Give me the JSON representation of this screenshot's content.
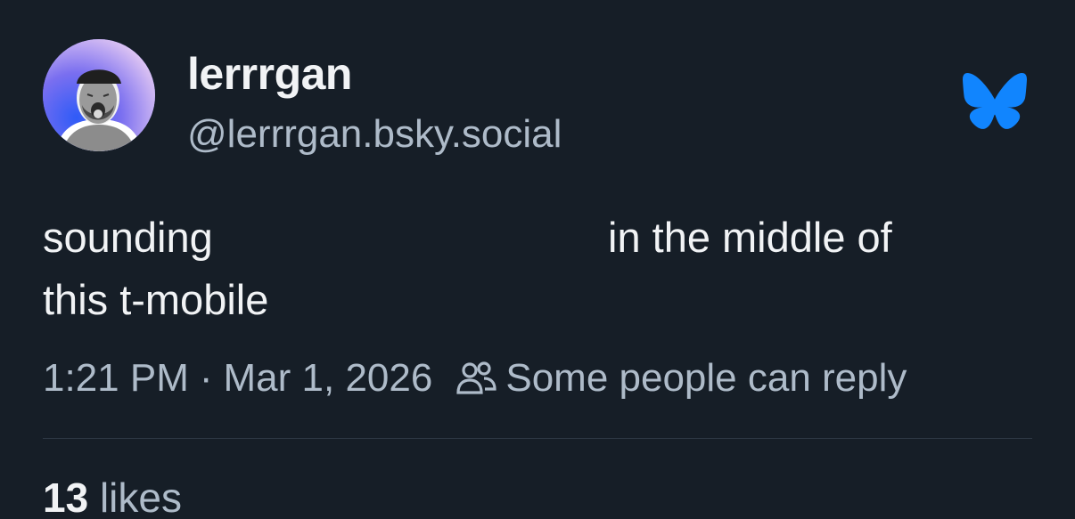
{
  "author": {
    "display_name": "lerrrgan",
    "handle": "@lerrrgan.bsky.social",
    "avatar": "avatar-photo"
  },
  "post": {
    "text_line1_left": "sounding",
    "text_line1_right": "in the middle of",
    "text_line2": "this t-mobile"
  },
  "meta": {
    "time": "1:21 PM",
    "separator": "·",
    "date": "Mar 1, 2026",
    "reply_icon": "people-icon",
    "reply_setting": "Some people can reply"
  },
  "stats": {
    "likes_count": "13",
    "likes_label": "likes"
  },
  "brand": {
    "logo": "bluesky-butterfly-icon",
    "accent": "#1185fe",
    "background": "#161e27"
  }
}
